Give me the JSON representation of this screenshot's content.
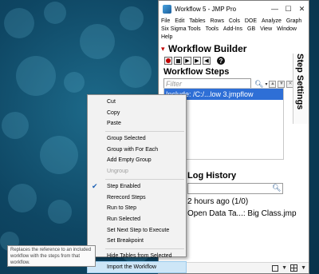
{
  "window": {
    "title": "Workflow 5 - JMP Pro",
    "controls": {
      "minimize": "—",
      "maximize": "☐",
      "close": "✕"
    }
  },
  "menubar": [
    "File",
    "Edit",
    "Tables",
    "Rows",
    "Cols",
    "DOE",
    "Analyze",
    "Graph",
    "Six Sigma Tools",
    "Tools",
    "Add-Ins",
    "GB",
    "View",
    "Window",
    "Help"
  ],
  "workflow_builder": {
    "title": "Workflow Builder",
    "help_glyph": "?"
  },
  "steps": {
    "title": "Workflow Steps",
    "filter_placeholder": "Filter",
    "items": [
      "Include: /C:/...low 3.jmpflow"
    ]
  },
  "log_history": {
    "title": "Log History",
    "lines": [
      "2 hours ago (1/0)",
      "Open Data Ta...: Big Class.jmp"
    ]
  },
  "step_settings": {
    "title": "Step Settings"
  },
  "context_menu": {
    "items": [
      {
        "label": "Cut",
        "disabled": false
      },
      {
        "label": "Copy",
        "disabled": false
      },
      {
        "label": "Paste",
        "disabled": false
      },
      {
        "sep": true
      },
      {
        "label": "Group Selected",
        "disabled": false
      },
      {
        "label": "Group with For Each",
        "disabled": false
      },
      {
        "label": "Add Empty Group",
        "disabled": false
      },
      {
        "label": "Ungroup",
        "disabled": true
      },
      {
        "sep": true
      },
      {
        "label": "Step Enabled",
        "disabled": false,
        "checked": true
      },
      {
        "label": "Rerecord Steps",
        "disabled": false
      },
      {
        "label": "Run to Step",
        "disabled": false
      },
      {
        "label": "Run Selected",
        "disabled": false
      },
      {
        "label": "Set Next Step to Execute",
        "disabled": false
      },
      {
        "label": "Set Breakpoint",
        "disabled": false
      },
      {
        "sep": true
      },
      {
        "label": "Hide Tables from Selected",
        "disabled": false
      },
      {
        "label": "Import the Workflow",
        "disabled": false,
        "highlighted": true
      }
    ]
  },
  "tooltip": {
    "text": "Replaces the reference to an included workflow with the steps from that workflow."
  },
  "icons": {
    "record": "record-icon",
    "stop": "stop-icon",
    "play": "play-icon",
    "step": "step-forward-icon",
    "rewind": "rewind-icon",
    "search": "search-icon"
  },
  "colors": {
    "record_red": "#c00000",
    "selection_blue": "#2e6fd6",
    "menu_highlight": "#cde6f7"
  }
}
